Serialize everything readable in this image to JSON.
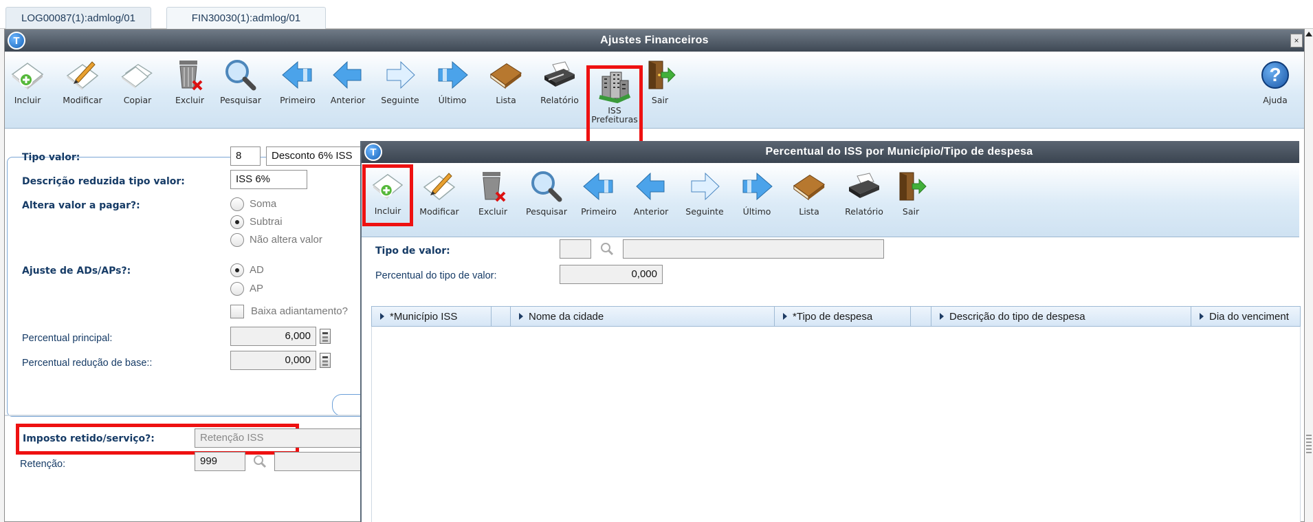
{
  "tabs": [
    {
      "label": "LOG00087(1):admlog/01"
    },
    {
      "label": "FIN30030(1):admlog/01"
    }
  ],
  "main": {
    "title": "Ajustes Financeiros",
    "logo": "T",
    "close": "×",
    "toolbar": [
      {
        "label": "Incluir",
        "icon": "add-icon"
      },
      {
        "label": "Modificar",
        "icon": "edit-icon"
      },
      {
        "label": "Copiar",
        "icon": "copy-icon"
      },
      {
        "label": "Excluir",
        "icon": "delete-icon"
      },
      {
        "label": "Pesquisar",
        "icon": "search-icon"
      },
      {
        "label": "Primeiro",
        "icon": "first-icon"
      },
      {
        "label": "Anterior",
        "icon": "previous-icon"
      },
      {
        "label": "Seguinte",
        "icon": "next-icon"
      },
      {
        "label": "Último",
        "icon": "last-icon"
      },
      {
        "label": "Lista",
        "icon": "list-icon"
      },
      {
        "label": "Relatório",
        "icon": "report-icon"
      },
      {
        "label": "ISS\nPrefeituras",
        "icon": "iss-buildings-icon",
        "highlighted": true
      },
      {
        "label": "Sair",
        "icon": "exit-icon"
      }
    ],
    "help": {
      "label": "Ajuda",
      "icon": "help-icon",
      "glyph": "?"
    },
    "form": {
      "tipo_valor_label": "Tipo valor:",
      "tipo_valor_code": "8",
      "tipo_valor_desc": "Desconto 6% ISS",
      "desc_reduzida_label": "Descrição reduzida tipo valor:",
      "desc_reduzida_value": "ISS 6%",
      "altera_valor_label": "Altera valor a pagar?:",
      "altera_options": [
        {
          "label": "Soma",
          "checked": false
        },
        {
          "label": "Subtrai",
          "checked": true
        },
        {
          "label": "Não altera valor",
          "checked": false
        }
      ],
      "ajuste_label": "Ajuste de ADs/APs?:",
      "ajuste_options": [
        {
          "label": "AD",
          "checked": true
        },
        {
          "label": "AP",
          "checked": false
        }
      ],
      "baixa_label": "Baixa adiantamento?",
      "perc_principal_label": "Percentual principal:",
      "perc_principal_value": "6,000",
      "perc_reducao_label": "Percentual redução de base::",
      "perc_reducao_value": "0,000",
      "imposto_label": "Imposto retido/serviço?:",
      "imposto_value": "Retenção ISS",
      "retencao_label": "Retenção:",
      "retencao_value": "999"
    }
  },
  "popup": {
    "title": "Percentual do ISS por Município/Tipo de despesa",
    "logo": "T",
    "toolbar": [
      {
        "label": "Incluir",
        "icon": "add-icon",
        "highlighted": true
      },
      {
        "label": "Modificar",
        "icon": "edit-icon"
      },
      {
        "label": "Excluir",
        "icon": "delete-icon"
      },
      {
        "label": "Pesquisar",
        "icon": "search-icon"
      },
      {
        "label": "Primeiro",
        "icon": "first-icon"
      },
      {
        "label": "Anterior",
        "icon": "previous-icon"
      },
      {
        "label": "Seguinte",
        "icon": "next-icon"
      },
      {
        "label": "Último",
        "icon": "last-icon"
      },
      {
        "label": "Lista",
        "icon": "list-icon"
      },
      {
        "label": "Relatório",
        "icon": "report-icon"
      },
      {
        "label": "Sair",
        "icon": "exit-icon"
      }
    ],
    "tipo_valor_label": "Tipo de valor:",
    "tipo_valor_code": "",
    "tipo_valor_desc": "",
    "percentual_label": "Percentual do tipo de valor:",
    "percentual_value": "0,000",
    "columns": [
      {
        "label": "*Município ISS"
      },
      {
        "label": ""
      },
      {
        "label": "Nome da cidade"
      },
      {
        "label": "*Tipo de despesa"
      },
      {
        "label": ""
      },
      {
        "label": "Descrição do tipo de despesa"
      },
      {
        "label": "Dia do venciment"
      }
    ]
  },
  "colors": {
    "highlight": "#ee1111",
    "titlebar": "#4a5563",
    "label": "#163b66"
  }
}
